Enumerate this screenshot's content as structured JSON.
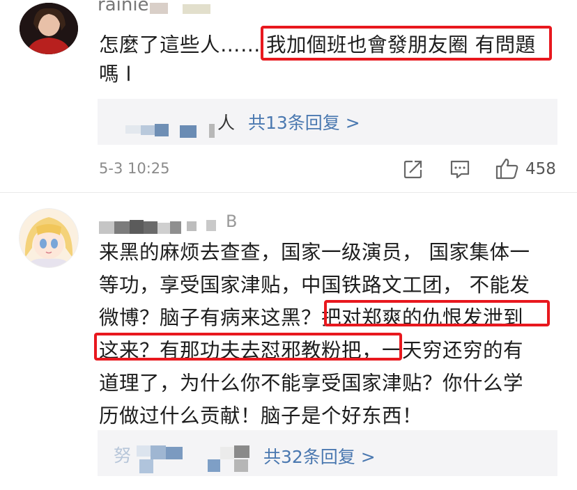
{
  "comments": [
    {
      "username": "rainie",
      "text_line1_a": "怎麼了這些人……",
      "text_line1_b": "我加個班也會發朋友圈 有問題",
      "text_line2": "嗎 l",
      "reply_prefix": "人",
      "reply_link": "共13条回复 >",
      "time": "5-3 10:25",
      "likes": "458"
    },
    {
      "username_suffix": "B",
      "lines": [
        "来黑的麻烦去查查，国家一级演员， 国家集体一",
        "等功，享受国家津贴，中国铁路文工团， 不能发",
        "微博？脑子有病来这黑？把对郑爽的仇恨发泄到",
        "这来？有那功夫去怼邪教粉把，一天穷还穷的有",
        "道理了，为什么你不能享受国家津贴？你什么学",
        "历做过什么贡献！脑子是个好东西！"
      ],
      "reply_prefix": "努",
      "reply_link": "共32条回复 >"
    }
  ],
  "colors": {
    "link": "#4a78b0",
    "highlight": "#e8181e",
    "reply_bg": "#f4f4f6"
  },
  "icons": [
    "share-icon",
    "comment-icon",
    "like-icon"
  ]
}
